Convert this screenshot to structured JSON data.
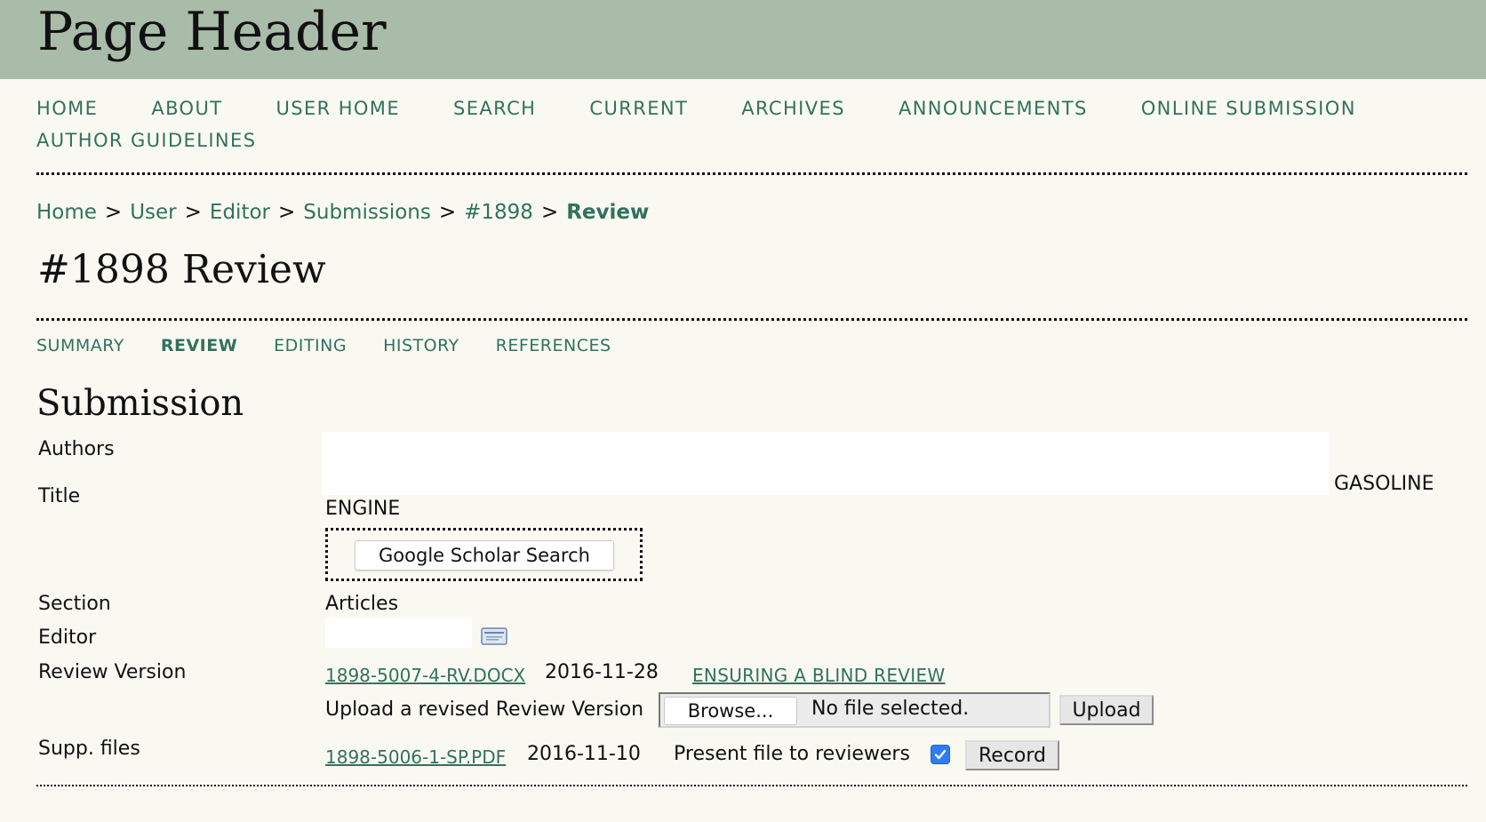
{
  "header": {
    "title": "Page Header"
  },
  "nav": {
    "items": [
      "HOME",
      "ABOUT",
      "USER HOME",
      "SEARCH",
      "CURRENT",
      "ARCHIVES",
      "ANNOUNCEMENTS",
      "ONLINE SUBMISSION",
      "AUTHOR GUIDELINES"
    ]
  },
  "breadcrumb": {
    "items": [
      "Home",
      "User",
      "Editor",
      "Submissions",
      "#1898"
    ],
    "separator": ">",
    "current": "Review"
  },
  "page": {
    "title": "#1898 Review"
  },
  "tabs": {
    "items": [
      "SUMMARY",
      "REVIEW",
      "EDITING",
      "HISTORY",
      "REFERENCES"
    ],
    "active": "REVIEW"
  },
  "submission": {
    "heading": "Submission",
    "labels": {
      "authors": "Authors",
      "title": "Title",
      "section": "Section",
      "editor": "Editor",
      "review_version": "Review Version",
      "supp_files": "Supp. files"
    },
    "title_tail": "GASOLINE",
    "title_line2": "ENGINE",
    "scholar_button": "Google Scholar Search",
    "section_value": "Articles",
    "review_file": "1898-5007-4-RV.DOCX",
    "review_date": "2016-11-28",
    "blind_review_link": "ENSURING A BLIND REVIEW",
    "upload_label": "Upload a revised Review Version",
    "browse_label": "Browse...",
    "no_file_text": "No file selected.",
    "upload_button": "Upload",
    "supp_file": "1898-5006-1-SP.PDF",
    "supp_date": "2016-11-10",
    "present_label": "Present file to reviewers",
    "present_checked": true,
    "record_button": "Record"
  },
  "colors": {
    "header_bg": "#a9bca9",
    "page_bg": "#f9f9f2",
    "link": "#32715d",
    "checkbox": "#2f7df6"
  }
}
